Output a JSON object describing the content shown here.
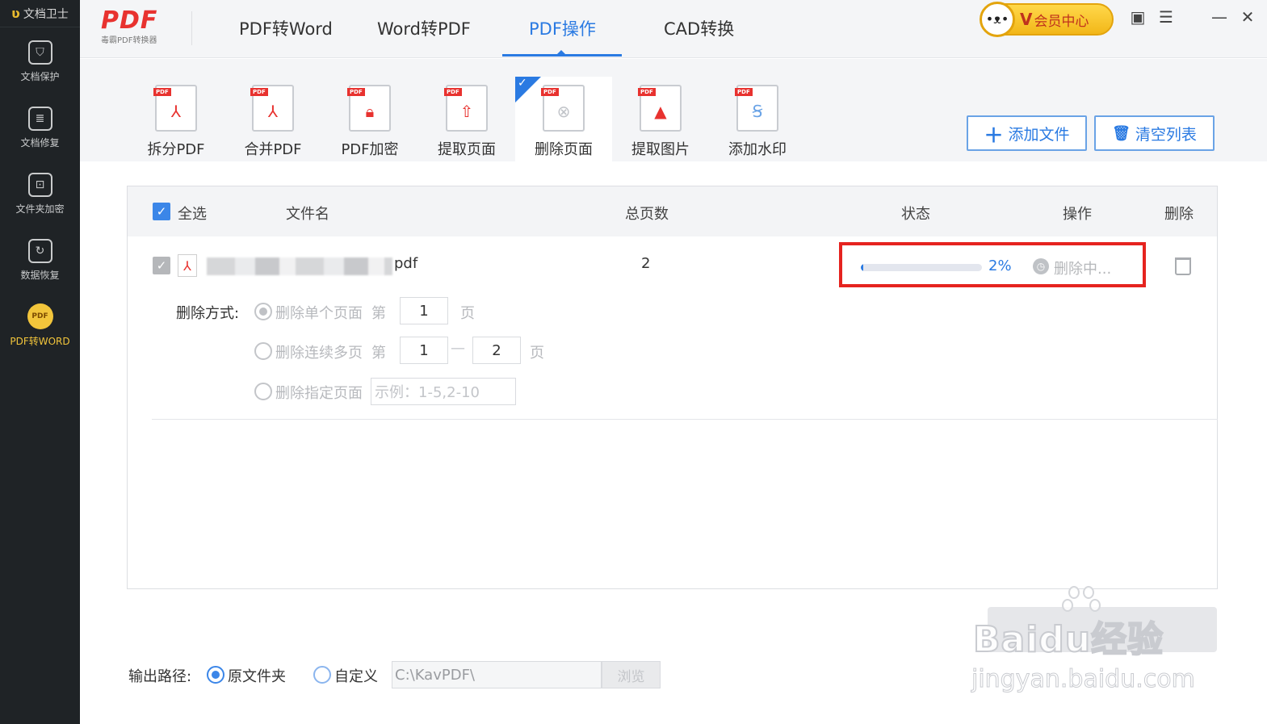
{
  "sidebar": {
    "brand": "文档卫士",
    "items": [
      {
        "label": "文档保护",
        "icon": "shield-icon"
      },
      {
        "label": "文档修复",
        "icon": "document-repair-icon"
      },
      {
        "label": "文件夹加密",
        "icon": "folder-lock-icon"
      },
      {
        "label": "数据恢复",
        "icon": "data-recovery-icon"
      },
      {
        "label": "PDF转WORD",
        "icon": "pdf-badge-icon",
        "active": true
      }
    ]
  },
  "logo": {
    "main": "PDF",
    "sub": "毒霸PDF转换器"
  },
  "main_tabs": [
    {
      "label": "PDF转Word"
    },
    {
      "label": "Word转PDF"
    },
    {
      "label": "PDF操作",
      "active": true
    },
    {
      "label": "CAD转换"
    }
  ],
  "vip": {
    "label": "会员中心",
    "v": "V"
  },
  "window_controls": [
    "skin-icon",
    "feedback-icon",
    "minimize-icon",
    "close-icon"
  ],
  "tools": [
    {
      "label": "拆分PDF",
      "icon": "split-pdf-icon"
    },
    {
      "label": "合并PDF",
      "icon": "merge-pdf-icon"
    },
    {
      "label": "PDF加密",
      "icon": "encrypt-pdf-icon"
    },
    {
      "label": "提取页面",
      "icon": "extract-pages-icon"
    },
    {
      "label": "删除页面",
      "icon": "delete-pages-icon",
      "active": true
    },
    {
      "label": "提取图片",
      "icon": "extract-images-icon"
    },
    {
      "label": "添加水印",
      "icon": "add-watermark-icon"
    }
  ],
  "actions": {
    "add_file": "添加文件",
    "clear_list": "清空列表"
  },
  "table": {
    "headers": {
      "select_all": "全选",
      "filename": "文件名",
      "pages": "总页数",
      "status": "状态",
      "operation": "操作",
      "delete": "删除"
    },
    "row": {
      "filename_suffix": "pdf",
      "pages": "2",
      "progress_percent": 2,
      "progress_text": "2%",
      "status_text": "删除中..."
    }
  },
  "delete_options": {
    "label": "删除方式:",
    "single": {
      "label": "删除单个页面",
      "prefix": "第",
      "value": "1",
      "suffix": "页"
    },
    "range": {
      "label": "删除连续多页",
      "prefix": "第",
      "from": "1",
      "to": "2",
      "suffix": "页"
    },
    "specific": {
      "label": "删除指定页面",
      "placeholder": "示例：1-5,2-10"
    }
  },
  "output": {
    "label": "输出路径:",
    "original": "原文件夹",
    "custom": "自定义",
    "path": "C:\\KavPDF\\",
    "browse": "浏览"
  },
  "watermark": {
    "text": "Baidu经验",
    "sub": "jingyan.baidu.com"
  },
  "colors": {
    "accent": "#2a7ae2",
    "highlight": "#e5231f",
    "brand_red": "#e8322f",
    "sidebar": "#1f2326",
    "vip": "#f2b719"
  }
}
